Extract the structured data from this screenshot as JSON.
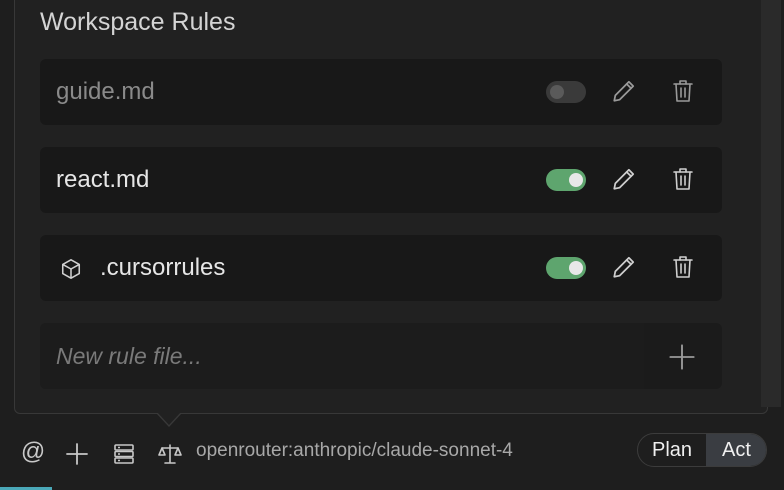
{
  "section": {
    "title": "Workspace Rules"
  },
  "rules": [
    {
      "name": "guide.md",
      "enabled": false,
      "icon": null
    },
    {
      "name": "react.md",
      "enabled": true,
      "icon": null
    },
    {
      "name": ".cursorrules",
      "enabled": true,
      "icon": "cube-icon"
    }
  ],
  "new_rule": {
    "placeholder": "New rule file...",
    "value": ""
  },
  "bottom_bar": {
    "icons": [
      "at-icon",
      "plus-icon",
      "server-icon",
      "scale-icon"
    ],
    "at_symbol": "@",
    "model": "openrouter:anthropic/claude-sonnet-4",
    "modes": {
      "plan": "Plan",
      "act": "Act",
      "active": "act"
    }
  },
  "colors": {
    "toggle_on": "#5ea56e",
    "toggle_off": "#3a3a3a",
    "active_mode_bg": "#3a3d42",
    "accent_strip": "#4aa8b8"
  }
}
